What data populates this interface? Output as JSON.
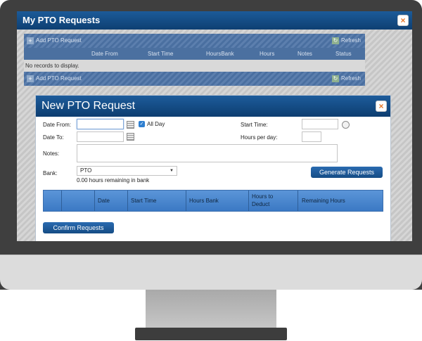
{
  "window": {
    "title": "My PTO Requests",
    "close_glyph": "×"
  },
  "grid": {
    "add_label": "Add PTO Request",
    "refresh_label": "Refresh",
    "columns": [
      "Date From",
      "Start Time",
      "HoursBank",
      "Hours",
      "Notes",
      "Status"
    ],
    "empty_message": "No records to display."
  },
  "dialog": {
    "title": "New PTO Request",
    "close_glyph": "×",
    "date_from_label": "Date From:",
    "date_from_value": "",
    "all_day_label": "All Day",
    "all_day_checked": true,
    "date_to_label": "Date To:",
    "date_to_value": "",
    "start_time_label": "Start Time:",
    "start_time_value": "",
    "hours_per_day_label": "Hours per day:",
    "hours_per_day_value": "",
    "notes_label": "Notes:",
    "notes_value": "",
    "bank_label": "Bank:",
    "bank_selected": "PTO",
    "bank_remaining": "0.00 hours remaining in bank",
    "generate_button": "Generate Requests",
    "table_columns": [
      "Date",
      "Start Time",
      "Hours Bank",
      "Hours to Deduct",
      "Remaining Hours"
    ],
    "confirm_button": "Confirm Requests"
  },
  "colors": {
    "title_bar": "#1c5b99",
    "grid_bar": "#4a6fa0",
    "close_accent": "#e8792b",
    "table_header": "#4f8bd2"
  },
  "icons": [
    "add-icon",
    "refresh-icon",
    "calendar-icon",
    "clock-icon",
    "checkbox-icon",
    "dropdown-arrow-icon",
    "close-icon"
  ]
}
